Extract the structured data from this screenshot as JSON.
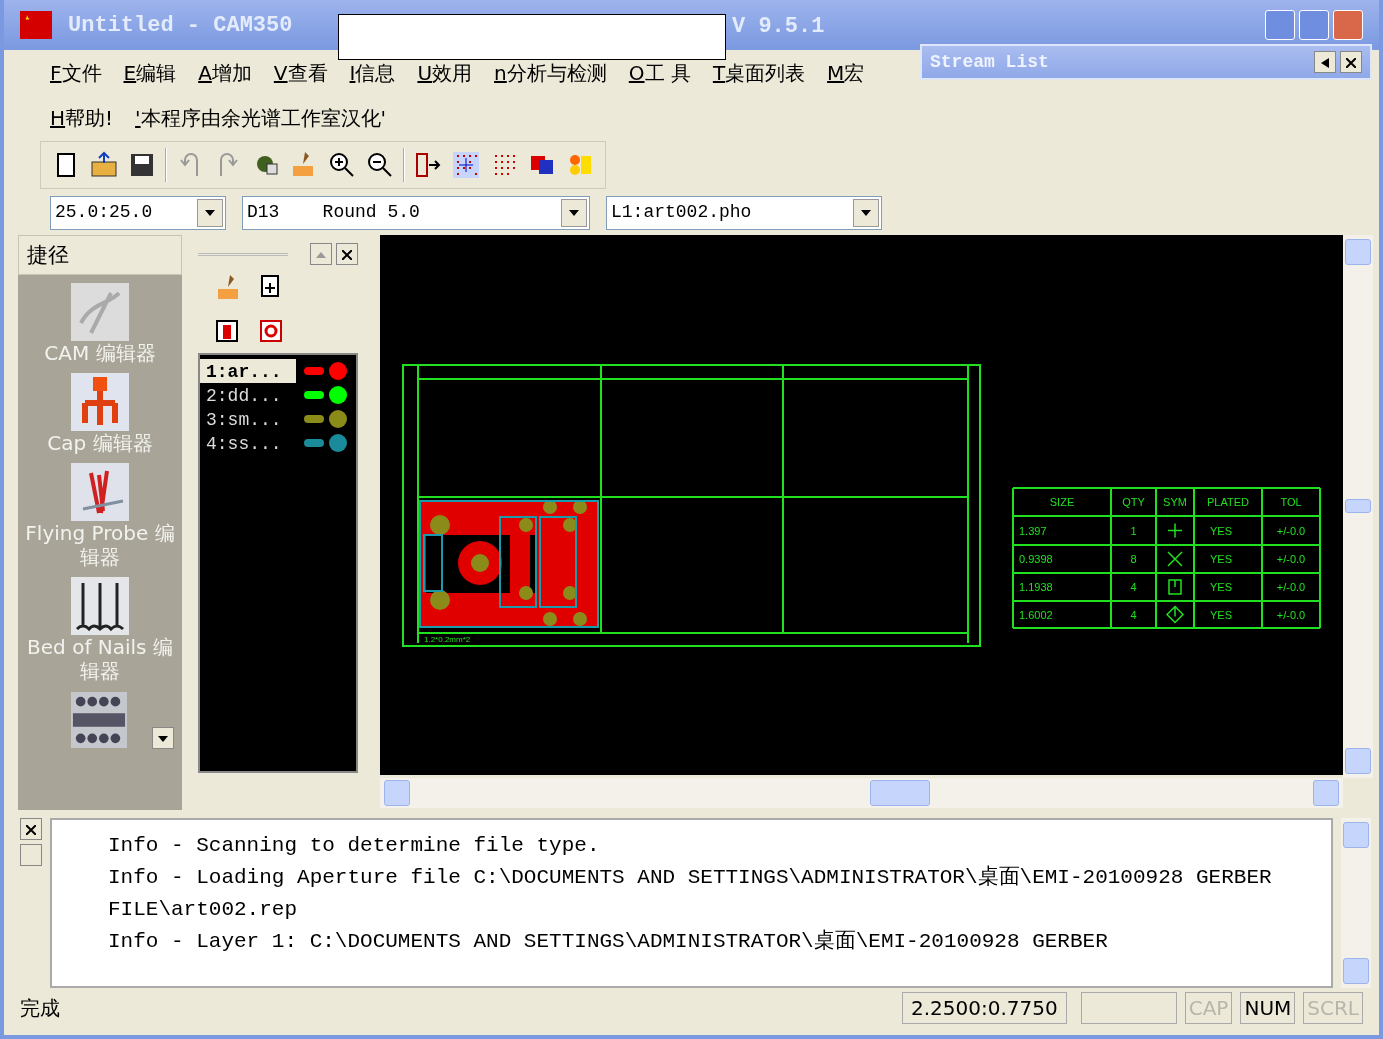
{
  "window": {
    "title": "Untitled - CAM350",
    "version": "V 9.5.1"
  },
  "menu": [
    {
      "label": "F文件"
    },
    {
      "label": "E编辑"
    },
    {
      "label": "A增加"
    },
    {
      "label": "V查看"
    },
    {
      "label": "I信息"
    },
    {
      "label": "U效用"
    },
    {
      "label": "n分析与检测"
    },
    {
      "label": "O工 具"
    },
    {
      "label": "T桌面列表"
    },
    {
      "label": "M宏"
    }
  ],
  "menu_row_2": [
    {
      "label": "H帮助!"
    },
    {
      "label": "'本程序由余光谱工作室汉化'"
    }
  ],
  "stream_list": {
    "title": "Stream List"
  },
  "combos": [
    {
      "value": "25.0:25.0"
    },
    {
      "value": "D13    Round 5.0"
    },
    {
      "value": "L1:art002.pho"
    }
  ],
  "shortcuts": {
    "title": "捷径",
    "items": [
      {
        "label": "CAM 编辑器",
        "kind": "cam"
      },
      {
        "label": "Cap 编辑器",
        "kind": "cap"
      },
      {
        "label": "Flying Probe 编辑器",
        "kind": "probe"
      },
      {
        "label": "Bed of Nails 编辑器",
        "kind": "nails"
      }
    ]
  },
  "layers": [
    {
      "label": "1:ar...",
      "selected": true,
      "color": "#ff0000"
    },
    {
      "label": "2:dd...",
      "selected": false,
      "color": "#00ff00"
    },
    {
      "label": "3:sm...",
      "selected": false,
      "color": "#8b8b1a"
    },
    {
      "label": "4:ss...",
      "selected": false,
      "color": "#1a8b9b"
    }
  ],
  "canvas": {
    "board_label": "1.2*0.2mm*2",
    "drill_table": {
      "columns": [
        "SIZE",
        "QTY",
        "SYM",
        "PLATED",
        "TOL"
      ],
      "rows": [
        {
          "size": "1.397",
          "qty": "1",
          "kind": "plus",
          "plated": "YES",
          "tol": "+/-0.0"
        },
        {
          "size": "0.9398",
          "qty": "8",
          "kind": "cross",
          "plated": "YES",
          "tol": "+/-0.0"
        },
        {
          "size": "1.1938",
          "qty": "4",
          "kind": "square",
          "plated": "YES",
          "tol": "+/-0.0"
        },
        {
          "size": "1.6002",
          "qty": "4",
          "kind": "diamond",
          "plated": "YES",
          "tol": "+/-0.0"
        }
      ]
    }
  },
  "log": {
    "lines": [
      "Info - Scanning to determine file type.",
      "Info - Loading Aperture file C:\\DOCUMENTS AND SETTINGS\\ADMINISTRATOR\\桌面\\EMI-20100928 GERBER FILE\\art002.rep",
      "Info - Layer 1: C:\\DOCUMENTS AND SETTINGS\\ADMINISTRATOR\\桌面\\EMI-20100928 GERBER"
    ]
  },
  "status": {
    "text": "完成",
    "coords": "2.2500:0.7750",
    "indicators": [
      {
        "label": "CAP",
        "on": false
      },
      {
        "label": "NUM",
        "on": true
      },
      {
        "label": "SCRL",
        "on": false
      }
    ]
  }
}
